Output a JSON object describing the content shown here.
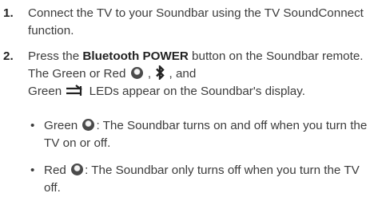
{
  "steps": [
    {
      "number": "1.",
      "text": "Connect the TV to your Soundbar using the TV SoundConnect function."
    },
    {
      "number": "2.",
      "text_before": "Press the ",
      "bold_text": "Bluetooth POWER",
      "text_after": " button on the Soundbar remote. The Green or Red",
      "text_comma": " ,",
      "text_and": " , and",
      "text_line3_start": "Green",
      "text_end": " LEDs appear on the Soundbar's display."
    }
  ],
  "bullets": [
    {
      "marker": "•",
      "lead": "Green",
      "text": ": The Soundbar turns on and off when you turn the TV on or off."
    },
    {
      "marker": "•",
      "lead": "Red",
      "text": ": The Soundbar only turns off when you turn the TV off."
    }
  ],
  "icons": [
    "led-circle-icon",
    "bluetooth-icon",
    "input-source-icon"
  ],
  "colors": {
    "text": "#3c3c3c",
    "emphasis": "#222222"
  }
}
